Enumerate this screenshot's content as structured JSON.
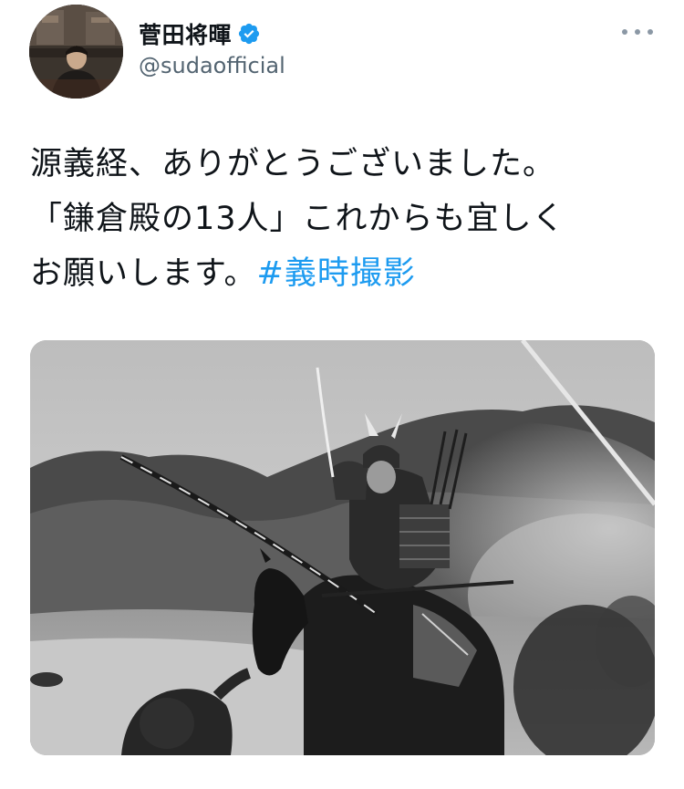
{
  "tweet": {
    "author": {
      "display_name": "菅田将暉",
      "handle": "@sudaofficial",
      "verified": true
    },
    "text_lines": [
      "源義経、ありがとうございました。",
      "「鎌倉殿の13人」これからも宜しく",
      "お願いします。"
    ],
    "hashtag": "#義時撮影",
    "media": {
      "type": "photo",
      "style": "black-and-white"
    }
  },
  "colors": {
    "text": "#0f1419",
    "secondary": "#536471",
    "link": "#1d9bf0",
    "verified_badge": "#1d9bf0"
  },
  "icons": {
    "verified": "verified-badge-icon",
    "more": "more-options-icon"
  }
}
